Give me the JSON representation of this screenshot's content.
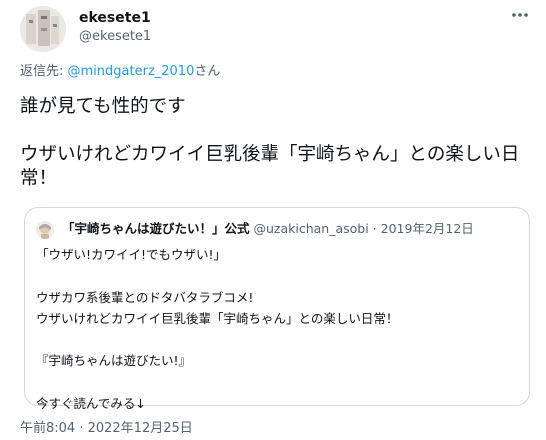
{
  "author": {
    "display_name": "ekesete1",
    "handle": "@ekesete1"
  },
  "reply_to": {
    "prefix": "返信先: ",
    "mention": "@mindgaterz_2010",
    "suffix": "さん"
  },
  "tweet_text": "誰が見ても性的です\n\nウザいけれどカワイイ巨乳後輩「宇崎ちゃん」との楽しい日常！",
  "quote": {
    "author_name": "「宇崎ちゃんは遊びたい！」公式",
    "meta": "@uzakichan_asobi · 2019年2月12日",
    "text": "「ウザい!カワイイ!でもウザい!」\n\nウザカワ系後輩とのドタバタラブコメ!\nウザいけれどカワイイ巨乳後輩「宇崎ちゃん」との楽しい日常！\n\n『宇崎ちゃんは遊びたい!』\n\n今すぐ読んでみる↓"
  },
  "timestamp": "午前8:04 · 2022年12月25日",
  "colors": {
    "text": "#0f1419",
    "secondary": "#536471",
    "link": "#1d9bf0",
    "border": "#cfd9de"
  },
  "icons": {
    "more": "more-dots-icon"
  }
}
